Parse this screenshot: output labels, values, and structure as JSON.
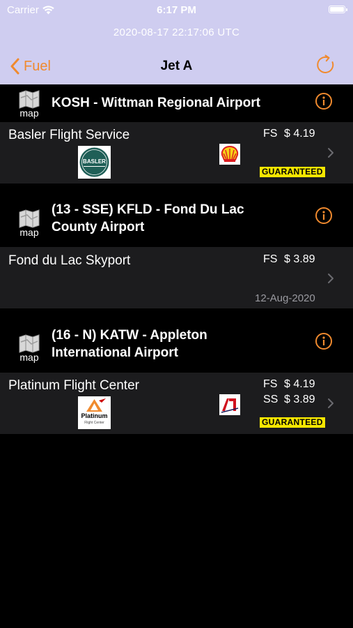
{
  "status_bar": {
    "carrier": "Carrier",
    "time": "6:17 PM"
  },
  "header": {
    "timestamp": "2020-08-17 22:17:06 UTC"
  },
  "nav": {
    "back_label": "Fuel",
    "title": "Jet A"
  },
  "map_label": "map",
  "sections": [
    {
      "airport": "KOSH - Wittman Regional Airport",
      "fbo": {
        "name": "Basler Flight Service",
        "logo_text": "BASLER",
        "brand": "shell",
        "prices": [
          {
            "type": "FS",
            "price": "$ 4.19"
          }
        ],
        "badge": "GUARANTEED"
      }
    },
    {
      "airport_line1": "(13 - SSE) KFLD - Fond Du Lac",
      "airport_line2": "County Airport",
      "fbo": {
        "name": "Fond du Lac Skyport",
        "prices": [
          {
            "type": "FS",
            "price": "$ 3.89"
          }
        ],
        "date": "12-Aug-2020"
      }
    },
    {
      "airport_line1": "(16 - N) KATW - Appleton",
      "airport_line2": "International Airport",
      "fbo": {
        "name": "Platinum Flight Center",
        "logo_text": "Platinum",
        "logo_subtext": "Flight Center",
        "brand": "avfuel",
        "prices": [
          {
            "type": "FS",
            "price": "$ 4.19"
          },
          {
            "type": "SS",
            "price": "$ 3.89"
          }
        ],
        "badge": "GUARANTEED"
      }
    }
  ],
  "colors": {
    "header_bg": "#cfcdf0",
    "accent": "#f08a2e",
    "row_bg": "#1c1c1e",
    "badge": "#f5e600"
  }
}
